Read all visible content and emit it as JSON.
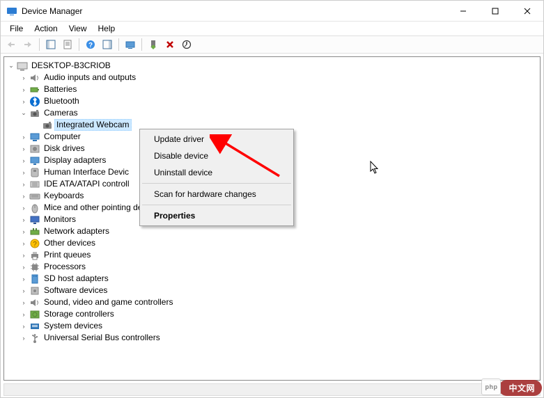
{
  "title": "Device Manager",
  "menus": [
    "File",
    "Action",
    "View",
    "Help"
  ],
  "root": "DESKTOP-B3CRIOB",
  "tree": [
    {
      "label": "Audio inputs and outputs",
      "icon": "speaker",
      "expandable": true
    },
    {
      "label": "Batteries",
      "icon": "battery",
      "expandable": true
    },
    {
      "label": "Bluetooth",
      "icon": "bluetooth",
      "expandable": true
    },
    {
      "label": "Cameras",
      "icon": "camera",
      "expandable": true,
      "expanded": true,
      "children": [
        {
          "label": "Integrated Webcam",
          "icon": "camera",
          "selected": true
        }
      ]
    },
    {
      "label": "Computer",
      "icon": "computer",
      "expandable": true
    },
    {
      "label": "Disk drives",
      "icon": "disk",
      "expandable": true
    },
    {
      "label": "Display adapters",
      "icon": "display",
      "expandable": true
    },
    {
      "label": "Human Interface Devic",
      "icon": "hid",
      "expandable": true
    },
    {
      "label": "IDE ATA/ATAPI controll",
      "icon": "ide",
      "expandable": true
    },
    {
      "label": "Keyboards",
      "icon": "keyboard",
      "expandable": true
    },
    {
      "label": "Mice and other pointing devices",
      "icon": "mouse",
      "expandable": true
    },
    {
      "label": "Monitors",
      "icon": "monitor",
      "expandable": true
    },
    {
      "label": "Network adapters",
      "icon": "network",
      "expandable": true
    },
    {
      "label": "Other devices",
      "icon": "other",
      "expandable": true
    },
    {
      "label": "Print queues",
      "icon": "printer",
      "expandable": true
    },
    {
      "label": "Processors",
      "icon": "cpu",
      "expandable": true
    },
    {
      "label": "SD host adapters",
      "icon": "sd",
      "expandable": true
    },
    {
      "label": "Software devices",
      "icon": "software",
      "expandable": true
    },
    {
      "label": "Sound, video and game controllers",
      "icon": "sound",
      "expandable": true
    },
    {
      "label": "Storage controllers",
      "icon": "storage",
      "expandable": true
    },
    {
      "label": "System devices",
      "icon": "system",
      "expandable": true
    },
    {
      "label": "Universal Serial Bus controllers",
      "icon": "usb",
      "expandable": true
    }
  ],
  "context_menu": [
    {
      "label": "Update driver",
      "type": "item"
    },
    {
      "label": "Disable device",
      "type": "item"
    },
    {
      "label": "Uninstall device",
      "type": "item"
    },
    {
      "type": "sep"
    },
    {
      "label": "Scan for hardware changes",
      "type": "item"
    },
    {
      "type": "sep"
    },
    {
      "label": "Properties",
      "type": "item",
      "bold": true
    }
  ],
  "watermark_text": "中文网"
}
